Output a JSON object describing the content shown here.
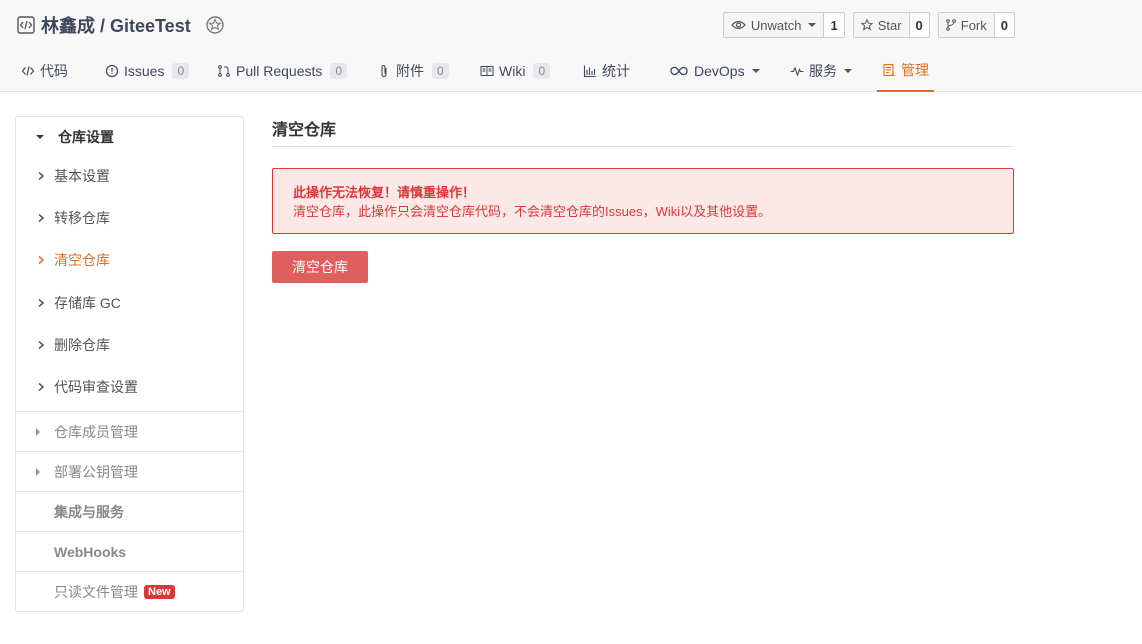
{
  "repo": {
    "title": "林鑫成 / GiteeTest"
  },
  "actions": {
    "watch": {
      "label": "Unwatch",
      "count": "1"
    },
    "star": {
      "label": "Star",
      "count": "0"
    },
    "fork": {
      "label": "Fork",
      "count": "0"
    }
  },
  "tabs": [
    {
      "label": "代码"
    },
    {
      "label": "Issues",
      "count": "0"
    },
    {
      "label": "Pull Requests",
      "count": "0"
    },
    {
      "label": "附件",
      "count": "0"
    },
    {
      "label": "Wiki",
      "count": "0"
    },
    {
      "label": "统计"
    },
    {
      "label": "DevOps"
    },
    {
      "label": "服务"
    },
    {
      "label": "管理"
    }
  ],
  "sidebar": {
    "group_title": "仓库设置",
    "items": [
      {
        "label": "基本设置"
      },
      {
        "label": "转移仓库"
      },
      {
        "label": "清空仓库"
      },
      {
        "label": "存储库 GC"
      },
      {
        "label": "删除仓库"
      },
      {
        "label": "代码审查设置"
      }
    ],
    "sections": [
      {
        "label": "仓库成员管理"
      },
      {
        "label": "部署公钥管理"
      },
      {
        "label": "集成与服务"
      },
      {
        "label": "WebHooks"
      },
      {
        "label": "只读文件管理",
        "badge": "New"
      }
    ]
  },
  "main": {
    "title": "清空仓库",
    "alert_title": "此操作无法恢复！请慎重操作！",
    "alert_text": "清空仓库，此操作只会清空仓库代码，不会清空仓库的Issues，Wiki以及其他设置。",
    "button_label": "清空仓库"
  },
  "colors": {
    "accent": "#da6f25",
    "danger": "#d93838",
    "danger_bg": "#fde8e8"
  }
}
